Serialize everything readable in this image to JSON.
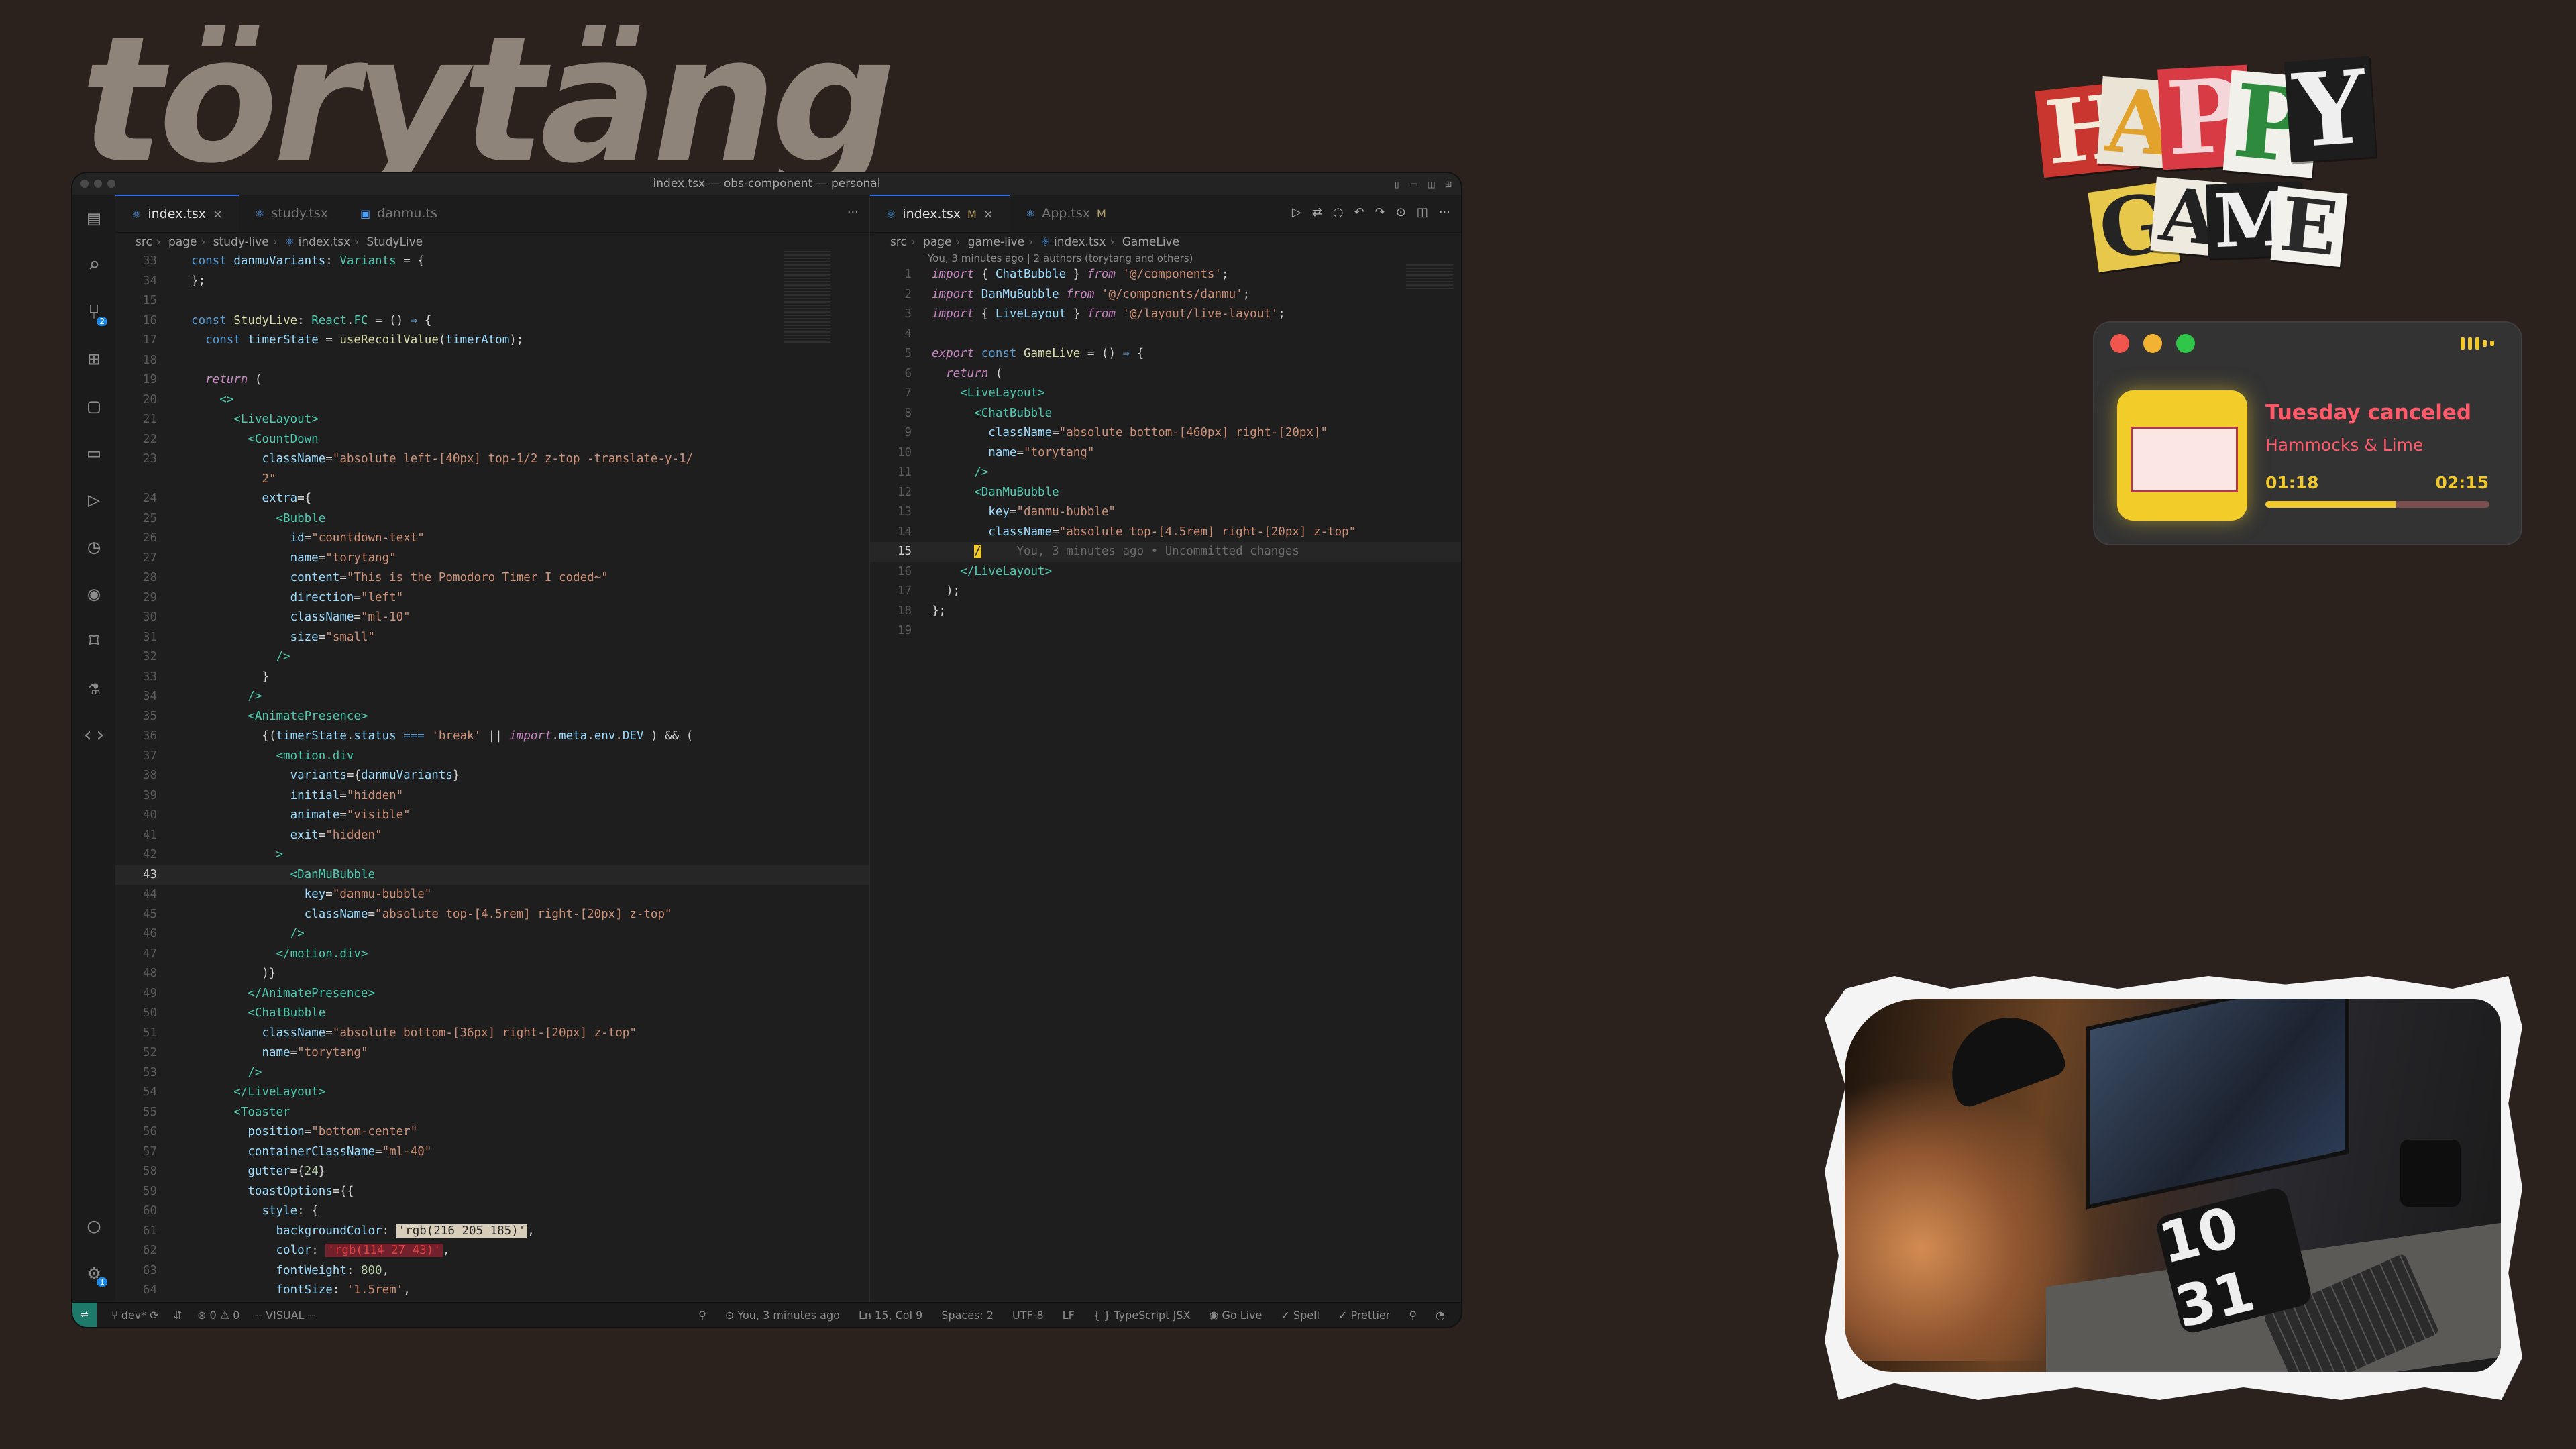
{
  "brand": "törytäng",
  "window": {
    "title": "index.tsx — obs-component — personal"
  },
  "activity_badges": {
    "scm": "2",
    "settings": "1"
  },
  "left_pane": {
    "tabs": [
      {
        "label": "index.tsx",
        "active": true,
        "close": "×"
      },
      {
        "label": "study.tsx",
        "active": false
      },
      {
        "label": "danmu.ts",
        "active": false
      }
    ],
    "more": "···",
    "breadcrumb": [
      "src",
      "page",
      "study-live",
      "index.tsx",
      "StudyLive"
    ]
  },
  "right_pane": {
    "tabs": [
      {
        "label": "index.tsx",
        "mod": "M",
        "active": true,
        "close": "×"
      },
      {
        "label": "App.tsx",
        "mod": "M",
        "active": false
      }
    ],
    "breadcrumb": [
      "src",
      "page",
      "game-live",
      "index.tsx",
      "GameLive"
    ],
    "blame": "You, 3 minutes ago | 2 authors (torytang and others)",
    "inline_blame": "You, 3 minutes ago • Uncommitted changes"
  },
  "status_bar": {
    "branch": "dev*",
    "problems": "⊗ 0 ⚠ 0",
    "mode": "-- VISUAL --",
    "git_blame": "You, 3 minutes ago",
    "position": "Ln 15, Col 9",
    "spaces": "Spaces: 2",
    "encoding": "UTF-8",
    "eol": "LF",
    "language": "TypeScript JSX",
    "golive": "Go Live",
    "spell": "Spell",
    "prettier": "Prettier"
  },
  "music": {
    "title": "Tuesday canceled",
    "artist": "Hammocks & Lime",
    "elapsed": "01:18",
    "total": "02:15",
    "progress": 0.58,
    "accent": "#f1c92c",
    "title_color": "#ff5a6a"
  },
  "sticker": {
    "line1": [
      "H",
      "A",
      "P",
      "P",
      "Y"
    ],
    "line2": [
      "G",
      "A",
      "M",
      "E"
    ]
  },
  "webcam": {
    "clock": "10 31"
  }
}
